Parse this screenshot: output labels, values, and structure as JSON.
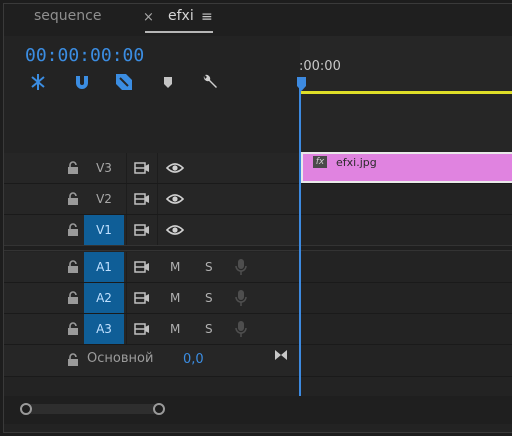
{
  "tabs": {
    "inactive": "sequence",
    "close_glyph": "×",
    "active": "efxi",
    "menu_glyph": "≡"
  },
  "timecode": "00:00:00:00",
  "ruler": {
    "time_label": ":00:00"
  },
  "tools": [
    "snap-icon",
    "linked-selection-icon",
    "add-marker-icon",
    "marker-icon",
    "wrench-icon"
  ],
  "video_tracks": [
    {
      "name": "V3",
      "targeted": false
    },
    {
      "name": "V2",
      "targeted": false
    },
    {
      "name": "V1",
      "targeted": true
    }
  ],
  "audio_tracks": [
    {
      "name": "A1",
      "mute": "M",
      "solo": "S"
    },
    {
      "name": "A2",
      "mute": "M",
      "solo": "S"
    },
    {
      "name": "A3",
      "mute": "M",
      "solo": "S"
    }
  ],
  "master": {
    "label": "Основной",
    "value": "0,0"
  },
  "clip": {
    "fx": "fx",
    "name": "efxi.jpg",
    "track": "V3",
    "color": "#e083e0"
  },
  "colors": {
    "accent": "#3b8de2",
    "work_area": "#dede28",
    "track_target": "#0f5e97"
  }
}
